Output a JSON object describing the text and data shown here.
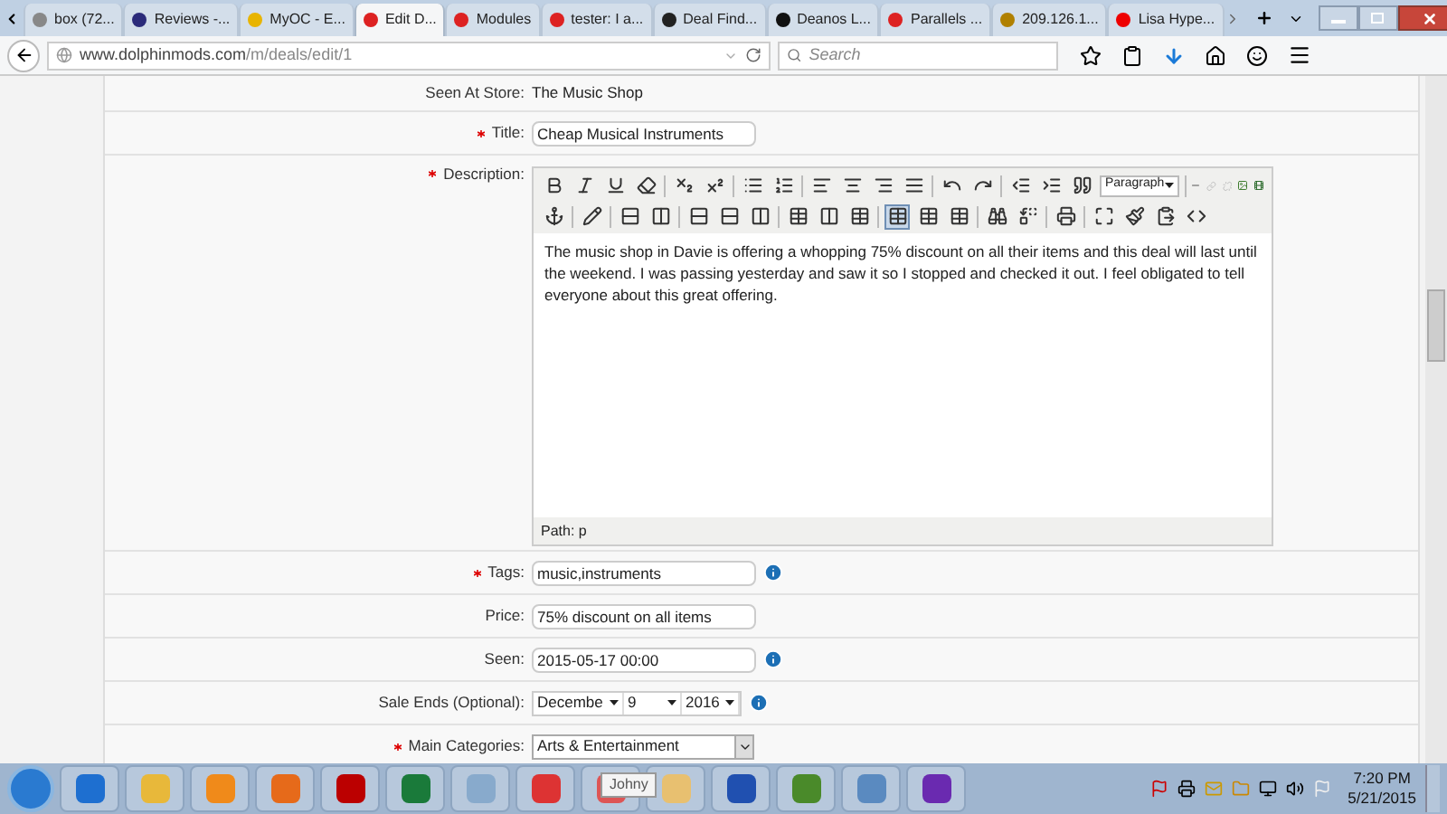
{
  "browser": {
    "tabs": [
      {
        "label": "box (72...",
        "selected": false
      },
      {
        "label": "Reviews -...",
        "selected": false
      },
      {
        "label": "MyOC - E...",
        "selected": false
      },
      {
        "label": "Edit D...",
        "selected": true
      },
      {
        "label": "Modules",
        "selected": false
      },
      {
        "label": "tester: I a...",
        "selected": false
      },
      {
        "label": "Deal Find...",
        "selected": false
      },
      {
        "label": "Deanos L...",
        "selected": false
      },
      {
        "label": "Parallels ...",
        "selected": false
      },
      {
        "label": "209.126.1...",
        "selected": false
      },
      {
        "label": "Lisa Hype...",
        "selected": false
      }
    ],
    "url": {
      "domain": "www.dolphinmods.com",
      "path": "/m/deals/edit/1"
    },
    "search": {
      "placeholder": "Search"
    }
  },
  "form": {
    "rows": [
      {
        "kind": "static",
        "label": "Seen At Store:",
        "required": false,
        "value": "The Music Shop"
      },
      {
        "kind": "text",
        "label": "Title:",
        "required": true,
        "value": "Cheap Musical Instruments",
        "info": false
      },
      {
        "kind": "editor",
        "label": "Description:",
        "required": true,
        "format": "Paragraph",
        "body": "The music shop in Davie is offering a whopping 75% discount on all their items and this deal will last until the weekend. I was passing yesterday and saw it so I stopped and checked it out. I feel obligated to tell everyone about this great offering.",
        "path": "Path: p"
      },
      {
        "kind": "text",
        "label": "Tags:",
        "required": true,
        "value": "music,instruments",
        "info": true
      },
      {
        "kind": "text",
        "label": "Price:",
        "required": false,
        "value": "75% discount on all items",
        "info": false
      },
      {
        "kind": "text",
        "label": "Seen:",
        "required": false,
        "value": "2015-05-17 00:00",
        "info": true
      },
      {
        "kind": "dates",
        "label": "Sale Ends (Optional):",
        "required": false,
        "values": [
          "Decembe",
          "9",
          "2016"
        ],
        "info": true
      },
      {
        "kind": "select",
        "label": "Main Categories:",
        "required": true,
        "value": "Arts & Entertainment"
      }
    ]
  },
  "taskbar": {
    "tooltip": "Johny",
    "time": "7:20 PM",
    "date": "5/21/2015"
  }
}
